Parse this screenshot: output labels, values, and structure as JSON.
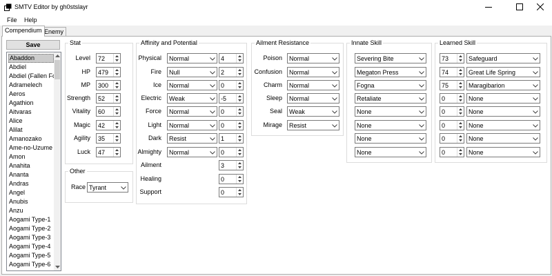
{
  "window": {
    "title": "SMTV Editor by gh0stslayr"
  },
  "menu": [
    "File",
    "Help"
  ],
  "tabs": [
    "Compendium",
    "Enemy"
  ],
  "save_label": "Save",
  "demon_list": [
    "Abaddon",
    "Abdiel",
    "Abdiel (Fallen Form)",
    "Adramelech",
    "Aeros",
    "Agathion",
    "Aitvaras",
    "Alice",
    "Alilat",
    "Amanozako",
    "Ame-no-Uzume",
    "Amon",
    "Anahita",
    "Ananta",
    "Andras",
    "Angel",
    "Anubis",
    "Anzu",
    "Aogami Type-1",
    "Aogami Type-2",
    "Aogami Type-3",
    "Aogami Type-4",
    "Aogami Type-5",
    "Aogami Type-6"
  ],
  "selected_demon": "Abaddon",
  "stat": {
    "legend": "Stat",
    "rows": [
      {
        "label": "Level",
        "value": "72"
      },
      {
        "label": "HP",
        "value": "479"
      },
      {
        "label": "MP",
        "value": "300"
      },
      {
        "label": "Strength",
        "value": "52"
      },
      {
        "label": "Vitality",
        "value": "60"
      },
      {
        "label": "Magic",
        "value": "42"
      },
      {
        "label": "Agility",
        "value": "35"
      },
      {
        "label": "Luck",
        "value": "47"
      }
    ]
  },
  "other": {
    "legend": "Other",
    "race_label": "Race",
    "race_value": "Tyrant"
  },
  "affinity": {
    "legend": "Affinity and Potential",
    "rows": [
      {
        "label": "Physical",
        "affinity": "Normal",
        "potential": "4"
      },
      {
        "label": "Fire",
        "affinity": "Null",
        "potential": "2"
      },
      {
        "label": "Ice",
        "affinity": "Normal",
        "potential": "0"
      },
      {
        "label": "Electric",
        "affinity": "Weak",
        "potential": "-5"
      },
      {
        "label": "Force",
        "affinity": "Normal",
        "potential": "0"
      },
      {
        "label": "Light",
        "affinity": "Normal",
        "potential": "0"
      },
      {
        "label": "Dark",
        "affinity": "Resist",
        "potential": "1"
      },
      {
        "label": "Almighty",
        "affinity": "Normal",
        "potential": "0"
      }
    ],
    "extra": [
      {
        "label": "Ailment",
        "potential": "3"
      },
      {
        "label": "Healing",
        "potential": "0"
      },
      {
        "label": "Support",
        "potential": "0"
      }
    ]
  },
  "ailment": {
    "legend": "Ailment Resistance",
    "rows": [
      {
        "label": "Poison",
        "value": "Normal"
      },
      {
        "label": "Confusion",
        "value": "Normal"
      },
      {
        "label": "Charm",
        "value": "Normal"
      },
      {
        "label": "Sleep",
        "value": "Normal"
      },
      {
        "label": "Seal",
        "value": "Weak"
      },
      {
        "label": "Mirage",
        "value": "Resist"
      }
    ]
  },
  "innate": {
    "legend": "Innate Skill",
    "skills": [
      "Severing Bite",
      "Megaton Press",
      "Fogna",
      "Retaliate",
      "None",
      "None",
      "None",
      "None"
    ]
  },
  "learned": {
    "legend": "Learned Skill",
    "rows": [
      {
        "level": "73",
        "skill": "Safeguard"
      },
      {
        "level": "74",
        "skill": "Great Life Spring"
      },
      {
        "level": "75",
        "skill": "Maragibarion"
      },
      {
        "level": "0",
        "skill": "None"
      },
      {
        "level": "0",
        "skill": "None"
      },
      {
        "level": "0",
        "skill": "None"
      },
      {
        "level": "0",
        "skill": "None"
      },
      {
        "level": "0",
        "skill": "None"
      }
    ]
  }
}
